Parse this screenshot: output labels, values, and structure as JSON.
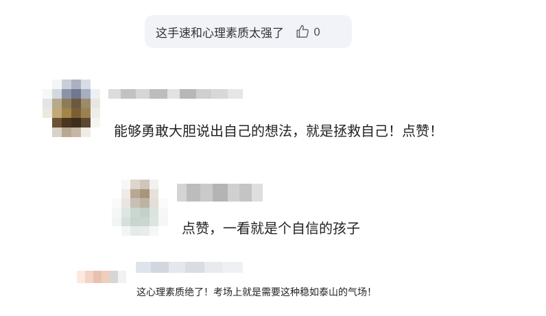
{
  "reply_bubble": {
    "text": "这手速和心理素质太强了",
    "like_icon": "thumbs-up-icon",
    "like_count": "0"
  },
  "comments": [
    {
      "avatar": "blurred-avatar",
      "username_blurred": true,
      "text": "能够勇敢大胆说出自己的想法，就是拯救自己！点赞！"
    },
    {
      "avatar": "blurred-avatar",
      "username_blurred": true,
      "text": "点赞，一看就是个自信的孩子"
    },
    {
      "avatar": "blurred-avatar",
      "username_blurred": true,
      "text": "这心理素质绝了！考场上就是需要这种稳如泰山的气场！"
    }
  ],
  "colors": {
    "bubble_bg": "#f1f3f9",
    "text": "#222222",
    "muted": "#555555"
  }
}
